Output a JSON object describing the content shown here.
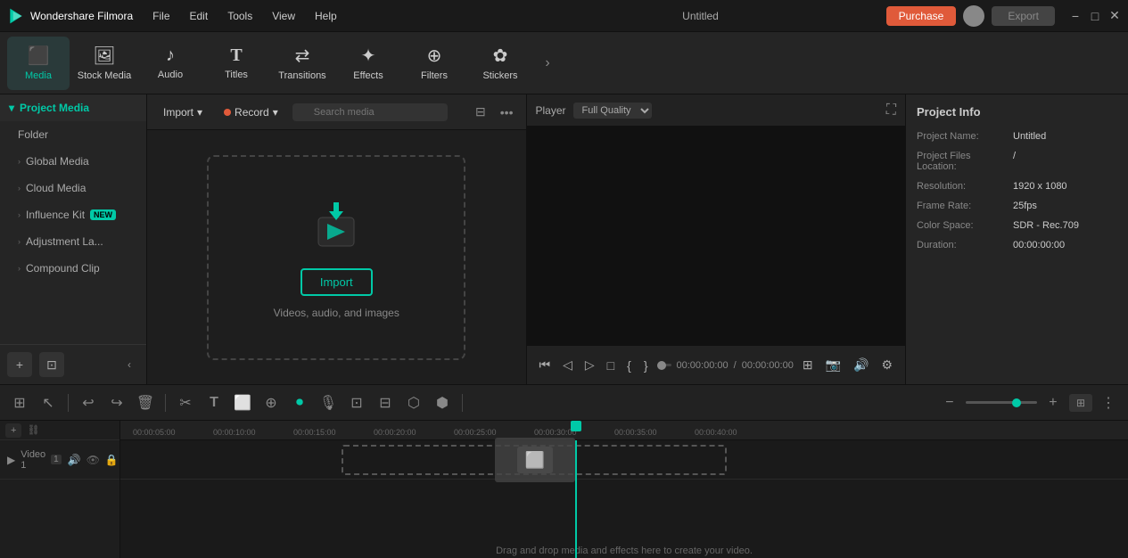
{
  "titlebar": {
    "logo": "filmora-logo",
    "app_name": "Wondershare Filmora",
    "menus": [
      "File",
      "Edit",
      "Tools",
      "View",
      "Help"
    ],
    "title": "Untitled",
    "purchase_label": "Purchase",
    "export_label": "Export"
  },
  "toolbar": {
    "items": [
      {
        "id": "media",
        "icon": "🎬",
        "label": "Media",
        "active": true
      },
      {
        "id": "stock-media",
        "icon": "🖼",
        "label": "Stock Media"
      },
      {
        "id": "audio",
        "icon": "🎵",
        "label": "Audio"
      },
      {
        "id": "titles",
        "icon": "T",
        "label": "Titles"
      },
      {
        "id": "transitions",
        "icon": "↔",
        "label": "Transitions"
      },
      {
        "id": "effects",
        "icon": "✨",
        "label": "Effects"
      },
      {
        "id": "filters",
        "icon": "🎨",
        "label": "Filters"
      },
      {
        "id": "stickers",
        "icon": "🌟",
        "label": "Stickers"
      }
    ]
  },
  "sidebar": {
    "header": "Project Media",
    "items": [
      {
        "id": "folder",
        "label": "Folder"
      },
      {
        "id": "global-media",
        "label": "Global Media"
      },
      {
        "id": "cloud-media",
        "label": "Cloud Media"
      },
      {
        "id": "influence-kit",
        "label": "Influence Kit",
        "badge": "NEW"
      },
      {
        "id": "adjustment-layer",
        "label": "Adjustment La..."
      },
      {
        "id": "compound-clip",
        "label": "Compound Clip"
      }
    ]
  },
  "media_panel": {
    "import_label": "Import",
    "record_label": "Record",
    "search_placeholder": "Search media",
    "drop_zone": {
      "import_btn": "Import",
      "hint": "Videos, audio, and images"
    }
  },
  "preview": {
    "tab_player": "Player",
    "quality": "Full Quality",
    "time_current": "00:00:00:00",
    "time_total": "00:00:00:00"
  },
  "project_info": {
    "title": "Project Info",
    "fields": [
      {
        "label": "Project Name:",
        "value": "Untitled"
      },
      {
        "label": "Project Files Location:",
        "value": "/"
      },
      {
        "label": "Resolution:",
        "value": "1920 x 1080"
      },
      {
        "label": "Frame Rate:",
        "value": "25fps"
      },
      {
        "label": "Color Space:",
        "value": "SDR - Rec.709"
      },
      {
        "label": "Duration:",
        "value": "00:00:00:00"
      }
    ]
  },
  "timeline": {
    "ruler_marks": [
      "00:00:05:00",
      "00:00:10:00",
      "00:00:15:00",
      "00:00:20:00",
      "00:00:25:00",
      "00:00:30:00",
      "00:00:35:00",
      "00:00:40:00"
    ],
    "drop_hint": "Drag and drop media and effects here to create your video.",
    "tracks": [
      {
        "label": "Video 1",
        "number": "1"
      }
    ]
  },
  "icons": {
    "search": "🔍",
    "chevron_down": "▾",
    "chevron_right": "›",
    "arrow_left": "‹",
    "more": "•••",
    "filter": "⊟",
    "undo": "↩",
    "redo": "↪",
    "delete": "🗑",
    "cut": "✂",
    "text": "T",
    "split": "⧉",
    "speed": "⚡",
    "record": "⏺",
    "zoom_minus": "−",
    "zoom_plus": "+",
    "collapse": "‹"
  }
}
